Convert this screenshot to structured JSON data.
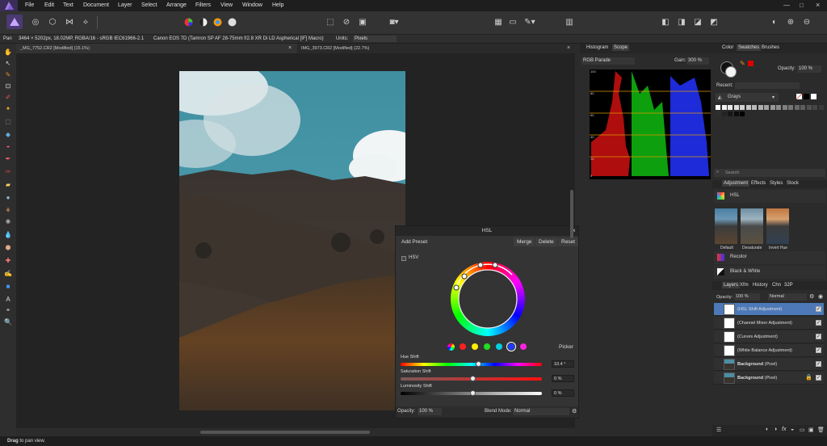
{
  "menu": [
    "File",
    "Edit",
    "Text",
    "Document",
    "Layer",
    "Select",
    "Arrange",
    "Filters",
    "View",
    "Window",
    "Help"
  ],
  "context": {
    "tool": "Pan",
    "info": "3464 × 5202px, 18.02MP, RGBA/16 - sRGB IEC61966-2.1",
    "lens": "Canon EOS 7D (Tamron SP AF 28-75mm f/2.8 XR Di LD Aspherical [IF] Macro)",
    "units_label": "Units:",
    "units_value": "Pixels"
  },
  "doc_tabs": [
    {
      "label": "_MG_7752.CR2 [Modified] (15.1%)",
      "close": "×"
    },
    {
      "label": "IMG_3973.CR2 [Modified] (22.7%)",
      "close": "×"
    }
  ],
  "hsl_panel": {
    "title": "HSL",
    "close": "×",
    "add_preset": "Add Preset",
    "merge": "Merge",
    "delete": "Delete",
    "reset": "Reset",
    "hsv_label": "HSV",
    "picker": "Picker",
    "hue_shift_label": "Hue Shift",
    "hue_shift_value": "10.4 °",
    "saturation_label": "Saturation Shift",
    "saturation_value": "0 %",
    "luminosity_label": "Luminosity Shift",
    "luminosity_value": "0 %",
    "opacity_label": "Opacity:",
    "opacity_value": "100 %",
    "blend_label": "Blend Mode:",
    "blend_value": "Normal",
    "color_dots": [
      "#ff2020",
      "#ffee00",
      "#22dd22",
      "#00d0e0",
      "#1e3cff",
      "#ff22dd"
    ]
  },
  "scope_panel": {
    "tabs": [
      "Histogram",
      "Scope"
    ],
    "mode": "RGB Parade",
    "gain_label": "Gain:",
    "gain_value": "300 %",
    "ticks": [
      "100",
      "80",
      "60",
      "40",
      "20",
      "0"
    ]
  },
  "color_panel": {
    "tabs": [
      "Color",
      "Swatches",
      "Brushes"
    ],
    "opacity_label": "Opacity:",
    "opacity_value": "100 %",
    "recent_label": "Recent:",
    "palette": "Grays"
  },
  "adjust_panel": {
    "search_placeholder": "Search",
    "tabs": [
      "Adjustment",
      "Effects",
      "Styles",
      "Stock"
    ],
    "hsl_label": "HSL",
    "presets": [
      "Default",
      "Desaturate",
      "Invert Hue"
    ],
    "recolor": "Recolor",
    "black_white": "Black & White"
  },
  "layers_panel": {
    "tabs": [
      "Layers",
      "Xfm",
      "History",
      "Chn",
      "32P"
    ],
    "opacity_label": "Opacity:",
    "opacity_value": "100 %",
    "blend_value": "Normal",
    "layers": [
      {
        "name": "(HSL Shift Adjustment)"
      },
      {
        "name": "(Channel Mixer Adjustment)"
      },
      {
        "name": "(Curves Adjustment)"
      },
      {
        "name": "(White Balance Adjustment)"
      },
      {
        "name": "Background",
        "kind": "(Pixel)"
      },
      {
        "name": "Background",
        "kind": "(Pixel)"
      }
    ]
  },
  "status": {
    "bold": "Drag",
    "text": "to pan view."
  }
}
